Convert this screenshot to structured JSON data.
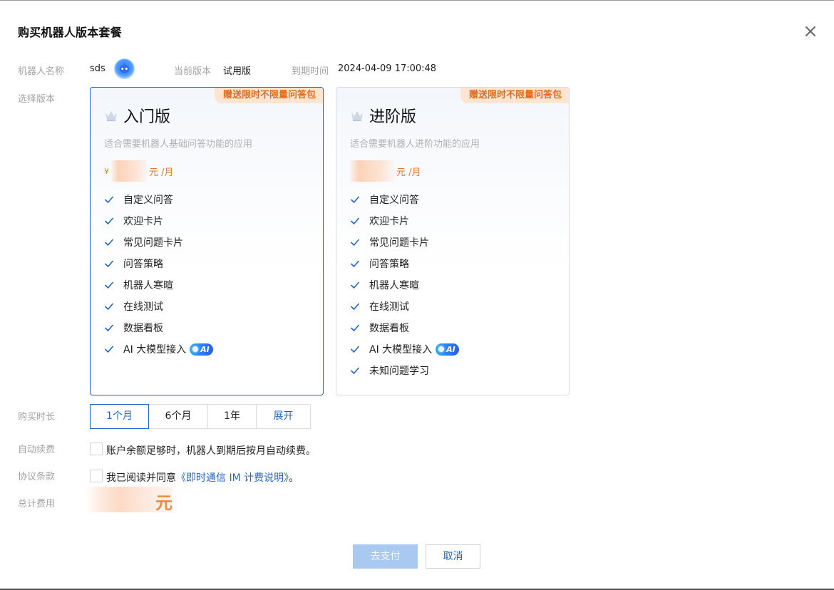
{
  "dialog": {
    "title": "购买机器人版本套餐",
    "close_icon": "close-icon"
  },
  "info": {
    "robot_name_label": "机器人名称",
    "robot_name": "sds",
    "current_version_label": "当前版本",
    "current_version": "试用版",
    "expire_label": "到期时间",
    "expire_time": "2024-04-09 17:00:48"
  },
  "select_version_label": "选择版本",
  "plans": [
    {
      "tag": "赠送限时不限量问答包",
      "name": "入门版",
      "desc": "适合需要机器人基础问答功能的应用",
      "currency": "¥",
      "unit": "元 /月",
      "selected": true,
      "features": [
        "自定义问答",
        "欢迎卡片",
        "常见问题卡片",
        "问答策略",
        "机器人寒暄",
        "在线测试",
        "数据看板",
        "AI 大模型接入"
      ]
    },
    {
      "tag": "赠送限时不限量问答包",
      "name": "进阶版",
      "desc": "适合需要机器人进阶功能的应用",
      "currency": "",
      "unit": "元 /月",
      "selected": false,
      "features": [
        "自定义问答",
        "欢迎卡片",
        "常见问题卡片",
        "问答策略",
        "机器人寒暄",
        "在线测试",
        "数据看板",
        "AI 大模型接入",
        "未知问题学习"
      ]
    }
  ],
  "ai_badge": "AI",
  "duration": {
    "label": "购买时长",
    "options": [
      "1个月",
      "6个月",
      "1年",
      "展开"
    ],
    "selected": "1个月"
  },
  "auto_renew": {
    "label": "自动续费",
    "text": "账户余额足够时，机器人到期后按月自动续费。",
    "checked": false
  },
  "agreement": {
    "label": "协议条款",
    "text_prefix": "我已阅读并同意",
    "link": "《即时通信 IM 计费说明》",
    "text_suffix": "。",
    "checked": false
  },
  "total": {
    "label": "总计费用",
    "unit_glyph": "元"
  },
  "buttons": {
    "pay": "去支付",
    "cancel": "取消"
  },
  "colors": {
    "accent": "#2166c7",
    "tag_bg": "#fde5d2",
    "tag_text": "#e36b1a",
    "pay_disabled": "#a9c9f0"
  }
}
